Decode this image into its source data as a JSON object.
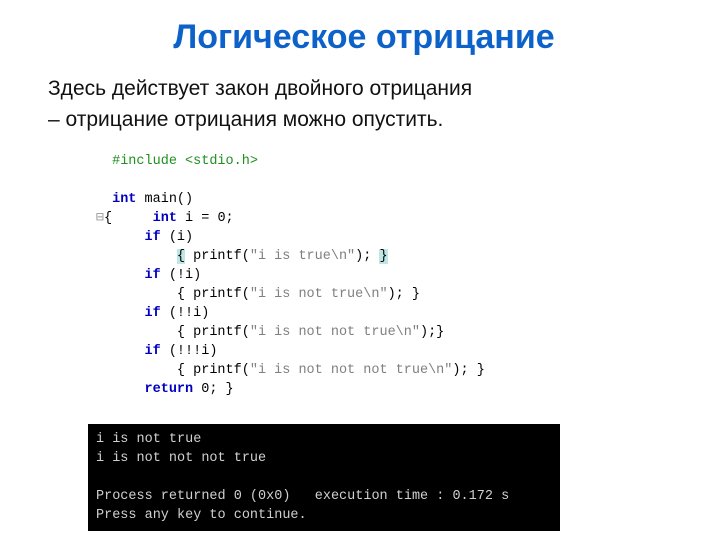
{
  "title": "Логическое отрицание",
  "subtitle_line1": "Здесь действует закон двойного отрицания",
  "subtitle_line2": "– отрицание отрицания можно опустить.",
  "code": {
    "l1": "#include <stdio.h>",
    "l3a": "int",
    "l3b": " main()",
    "l4a": "{",
    "l4b": "int",
    "l4c": " i = 0;",
    "l5a": "if",
    "l5b": " (i)",
    "l6a": "{",
    "l6b": " printf(",
    "l6c": "\"i is true\\n\"",
    "l6d": "); ",
    "l6e": "}",
    "l7a": "if",
    "l7b": " (!i)",
    "l8a": "{ printf(",
    "l8b": "\"i is not true\\n\"",
    "l8c": "); }",
    "l9a": "if",
    "l9b": " (!!i)",
    "l10a": "{ printf(",
    "l10b": "\"i is not not true\\n\"",
    "l10c": ");}",
    "l11a": "if",
    "l11b": " (!!!i)",
    "l12a": "{ printf(",
    "l12b": "\"i is not not not true\\n\"",
    "l12c": "); }",
    "l13a": "return",
    "l13b": " 0; }"
  },
  "console": {
    "l1": "i is not true",
    "l2": "i is not not not true",
    "l3": "",
    "l4": "Process returned 0 (0x0)   execution time : 0.172 s",
    "l5": "Press any key to continue."
  }
}
